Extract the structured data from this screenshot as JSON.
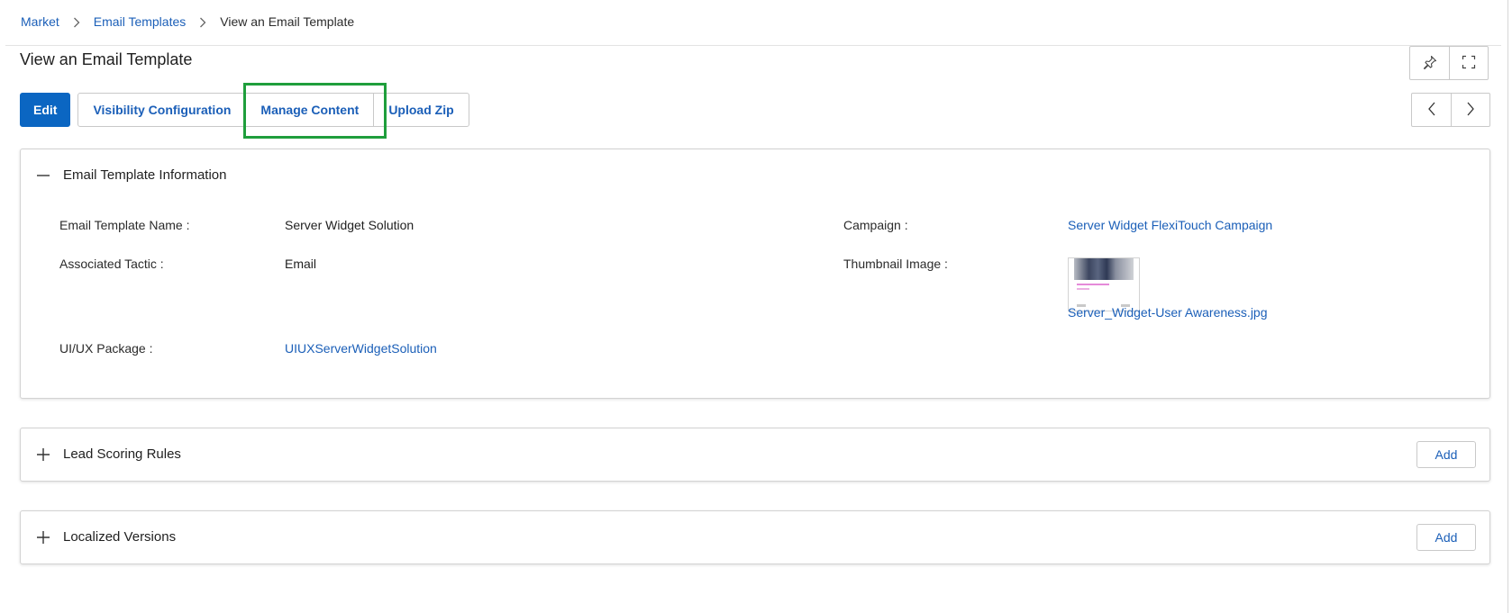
{
  "breadcrumb": {
    "items": [
      {
        "label": "Market"
      },
      {
        "label": "Email Templates"
      }
    ],
    "current": "View an Email Template"
  },
  "page": {
    "title": "View an Email Template"
  },
  "toolbar": {
    "edit_label": "Edit",
    "visibility_label": "Visibility Configuration",
    "manage_content_label": "Manage Content",
    "upload_zip_label": "Upload Zip"
  },
  "header_actions": {
    "pin_icon": "pin-icon",
    "fullscreen_icon": "fullscreen-icon",
    "prev_icon": "chevron-left-icon",
    "next_icon": "chevron-right-icon"
  },
  "info": {
    "title": "Email Template Information",
    "fields": {
      "name_label": "Email Template Name :",
      "name_value": "Server Widget Solution",
      "tactic_label": "Associated Tactic :",
      "tactic_value": "Email",
      "package_label": "UI/UX Package :",
      "package_value": "UIUXServerWidgetSolution",
      "campaign_label": "Campaign :",
      "campaign_value": "Server Widget FlexiTouch Campaign",
      "thumbnail_label": "Thumbnail Image :",
      "thumbnail_file": "Server_Widget-User Awareness.jpg"
    }
  },
  "lead_scoring": {
    "title": "Lead Scoring Rules",
    "add_label": "Add"
  },
  "localized": {
    "title": "Localized Versions",
    "add_label": "Add"
  },
  "colors": {
    "primary": "#0b66c2",
    "link": "#1b5fb8",
    "highlight": "#1f9e3c"
  }
}
